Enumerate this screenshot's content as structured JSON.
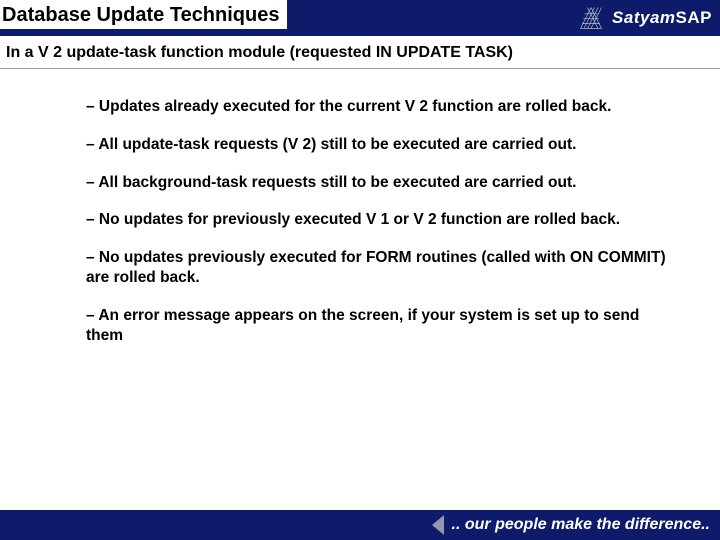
{
  "header": {
    "title": "Database Update Techniques",
    "brand_prefix": "Satyam",
    "brand_suffix": "SAP"
  },
  "subtitle": "In a V 2 update-task function module (requested IN UPDATE TASK)",
  "bullets": [
    "– Updates already executed for the current V 2 function are rolled back.",
    "– All update-task requests (V 2) still to be executed are carried out.",
    "– All background-task requests still to be executed are carried out.",
    "– No updates for previously executed V 1 or V 2 function are rolled back.",
    "– No updates previously executed for FORM routines (called with ON COMMIT) are rolled back.",
    "– An error message appears on the screen, if your system is set up to send them"
  ],
  "footer": {
    "tagline": ".. our people make the difference.."
  }
}
